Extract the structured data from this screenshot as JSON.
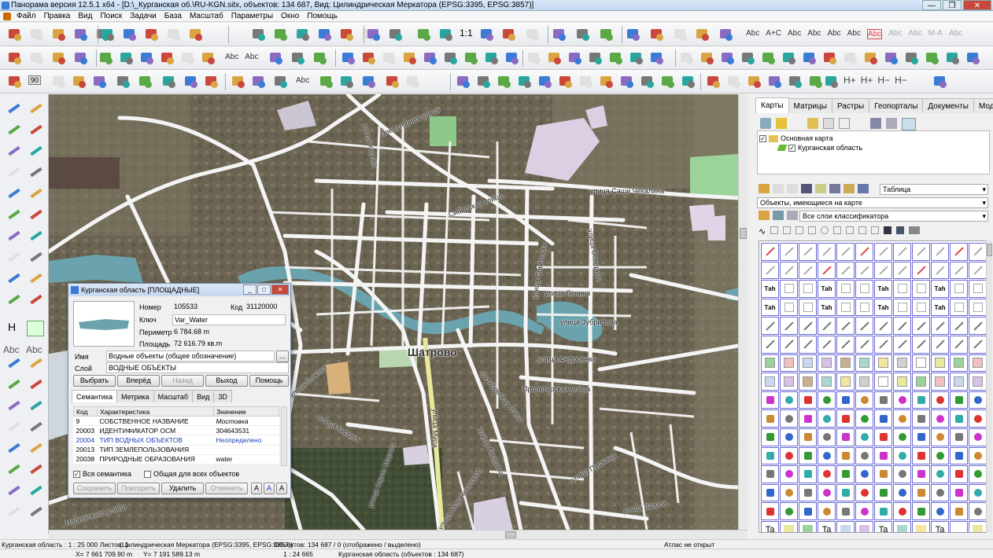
{
  "window": {
    "title": "Панорама версия 12.5.1 x64 - [D:\\_Курганская об.\\RU-KGN.sitx, объектов: 134 687, Вид: Цилиндрическая Меркатора (EPSG:3395, EPSG:3857)]",
    "controls": [
      "—",
      "❐",
      "✕"
    ]
  },
  "menu": [
    "Файл",
    "Правка",
    "Вид",
    "Поиск",
    "Задачи",
    "База",
    "Масштаб",
    "Параметры",
    "Окно",
    "Помощь"
  ],
  "toolbar1": {
    "scale_label": "1:1",
    "text_tools": [
      "Abc",
      "A+C",
      "Abc",
      "Abc",
      "Abc",
      "Abc",
      "Abc",
      "Abc",
      "Abc",
      "M-A",
      "Abc"
    ]
  },
  "toolbar2": {
    "text_tools": [
      "Abc",
      "Abc"
    ]
  },
  "toolbar3": {
    "angle_label": "90",
    "text_tool": "Abc",
    "height_tools": [
      "H+",
      "H+",
      "H−",
      "H−"
    ]
  },
  "left_tools": {
    "h_label": "H",
    "abc1": "Abc",
    "abc2": "Abc"
  },
  "map": {
    "labels": {
      "city": "Шатрово",
      "street1": "улица Саши Чекалина",
      "street2": "улица Ленина",
      "street3": "улица Зубрилова",
      "street4": "улица Федосеева",
      "street5": "Пролетарская улица",
      "street6": "Сибирская улица",
      "street7": "Элеваторная улица",
      "street8": "улица Кирова",
      "street9": "улица Мира",
      "street10": "улица Кирова",
      "street11": "улица Пушкина",
      "street12": "улица Карла Маркса",
      "street13": "Октябрьская улица",
      "street14": "улица Советская",
      "street15": "улица Гагарина",
      "street16": "Набережная улица",
      "street17": "улица Механизаторов",
      "street18": "улица Северная",
      "street19": "улица Щорса",
      "street20": "улица Бажова"
    }
  },
  "dialog": {
    "title": "Курганская область [ПЛОЩАДНЫЕ]",
    "fields": {
      "number_label": "Номер",
      "number": "105533",
      "code_label": "Код",
      "code": "31120000",
      "key_label": "Ключ",
      "key": "Var_Water",
      "perimeter_label": "Периметр",
      "perimeter": "6 784.68 m",
      "area_label": "Площадь",
      "area": "72 616.79 кв.m",
      "name_label": "Имя",
      "name": "Водные объекты (общее обозначение)",
      "layer_label": "Слой",
      "layer": "ВОДНЫЕ ОБЪЕКТЫ"
    },
    "buttons1": [
      "Выбрать",
      "Вперёд",
      "Назад",
      "Выход",
      "Помощь"
    ],
    "tabs": [
      "Семантика",
      "Метрика",
      "Масштаб",
      "Вид",
      "3D"
    ],
    "table": {
      "headers": [
        "Код",
        "Характеристика",
        "Значение"
      ],
      "rows": [
        [
          "9",
          "СОБСТВЕННОЕ НАЗВАНИЕ",
          "Мостовка"
        ],
        [
          "20003",
          "ИДЕНТИФИКАТОР ОСМ",
          "304643531"
        ],
        [
          "20004",
          "ТИП ВОДНЫХ ОБЪЕКТОВ",
          "Неопределено"
        ],
        [
          "20013",
          "ТИП ЗЕМЛЕПОЛЬЗОВАНИЯ",
          ""
        ],
        [
          "20038",
          "ПРИРОДНЫЕ ОБРАЗОВАНИЯ",
          "water"
        ]
      ]
    },
    "check_all": "Вся семантика",
    "check_common": "Общая для всех объектов",
    "buttons2": [
      "Сохранить",
      "Повторить",
      "Удалить",
      "Отменить"
    ],
    "font_buttons": [
      "A",
      "A",
      "A"
    ]
  },
  "right_panel": {
    "tabs": [
      "Карты",
      "Матрицы",
      "Растры",
      "Геопорталы",
      "Документы",
      "Модели"
    ],
    "tree": {
      "root": "Основная карта",
      "child": "Курганская область"
    },
    "view_combo": "Таблица",
    "objects_combo": "Объекты, имеющиеся на карте",
    "layers_combo": "Все слои классификатора",
    "grid_text_glyph": "Таh",
    "grid_sample_text": "Ta"
  },
  "status": {
    "line1_left": "Курганская область : 1 : 25 000  Листов: 1",
    "line1_proj": "(Цилиндрическая Меркатора (EPSG:3395, EPSG:3857))",
    "line1_objects": "Объектов: 134 687 / 0 (отображено / выделено)",
    "line1_atlas": "Атлас не открыт",
    "line2_x": "X= 7 661 709.90 m",
    "line2_y": "Y= 7 191 589.13 m",
    "line2_scale": "1 : 24 665",
    "line2_region": "Курганская область  (объектов : 134 687)"
  },
  "colors": {
    "map_bg": "#6e6a58",
    "road": "#f4f4f4",
    "water": "#6aa3ad",
    "highlight_road": "#e8e89a",
    "grid_border": "#6b6bd6"
  }
}
